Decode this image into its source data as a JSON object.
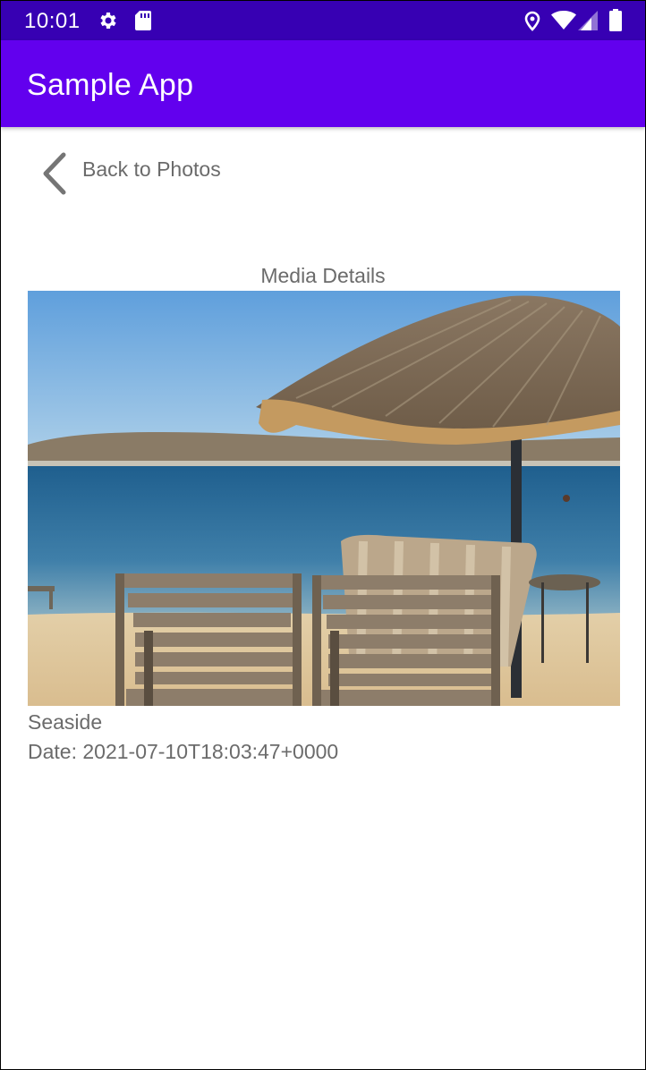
{
  "status_bar": {
    "time": "10:01",
    "icons": [
      "settings-icon",
      "sd-card-icon",
      "location-icon",
      "wifi-icon",
      "signal-icon",
      "battery-icon"
    ]
  },
  "app_bar": {
    "title": "Sample App",
    "color": "#6200ee"
  },
  "back": {
    "label": "Back to Photos",
    "icon": "chevron-left-icon"
  },
  "details": {
    "section_title": "Media Details",
    "caption": "Seaside",
    "date": "Date: 2021-07-10T18:03:47+0000"
  },
  "colors": {
    "status_bar": "#3700b3",
    "app_bar": "#6200ee",
    "text_secondary": "#6b6b6b"
  }
}
